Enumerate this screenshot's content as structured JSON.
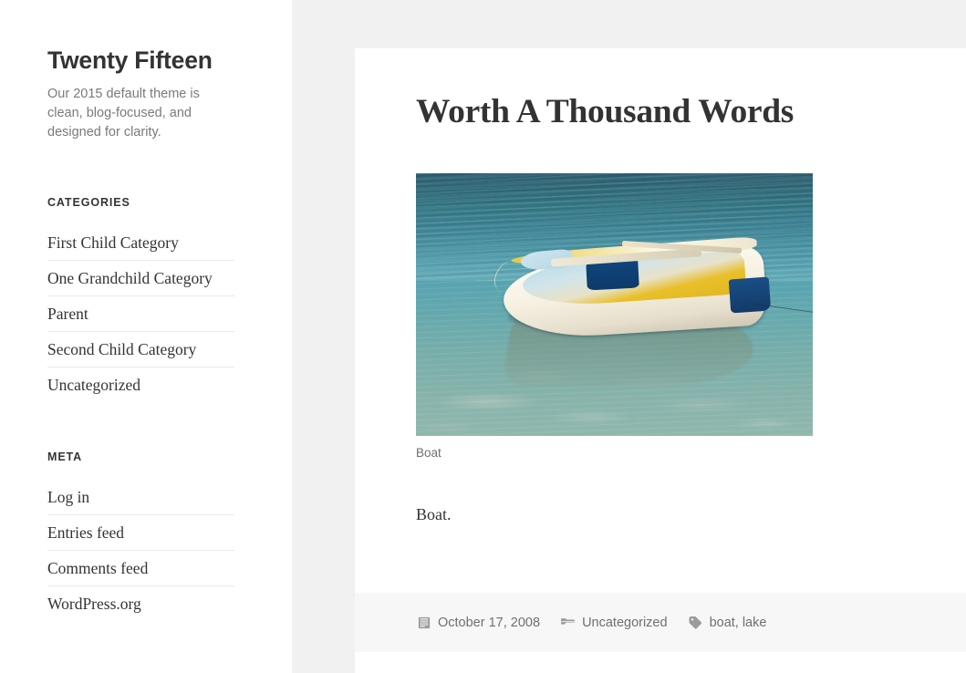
{
  "sidebar": {
    "site_title": "Twenty Fifteen",
    "site_description": "Our 2015 default theme is clean, blog-focused, and designed for clarity.",
    "widgets": [
      {
        "id": "categories",
        "title": "CATEGORIES",
        "items": [
          "First Child Category",
          "One Grandchild Category",
          "Parent",
          "Second Child Category",
          "Uncategorized"
        ]
      },
      {
        "id": "meta",
        "title": "META",
        "items": [
          "Log in",
          "Entries feed",
          "Comments feed",
          "WordPress.org"
        ]
      }
    ]
  },
  "article": {
    "title": "Worth A Thousand Words",
    "figure": {
      "alt": "Boat",
      "caption": "Boat"
    },
    "body": "Boat.",
    "footer": {
      "date_icon": "calendar-icon",
      "date": "October 17, 2008",
      "category_icon": "folder-icon",
      "category": "Uncategorized",
      "tag_icon": "tag-icon",
      "tags": [
        "boat",
        "lake"
      ],
      "tag_separator": ","
    }
  },
  "colors": {
    "page_background": "#ffffff",
    "content_background": "#f1f1f1",
    "card_background": "#ffffff",
    "footer_background": "#f7f7f7",
    "text_primary": "#333333",
    "text_muted": "#707070",
    "rule": "#eaeaea"
  }
}
